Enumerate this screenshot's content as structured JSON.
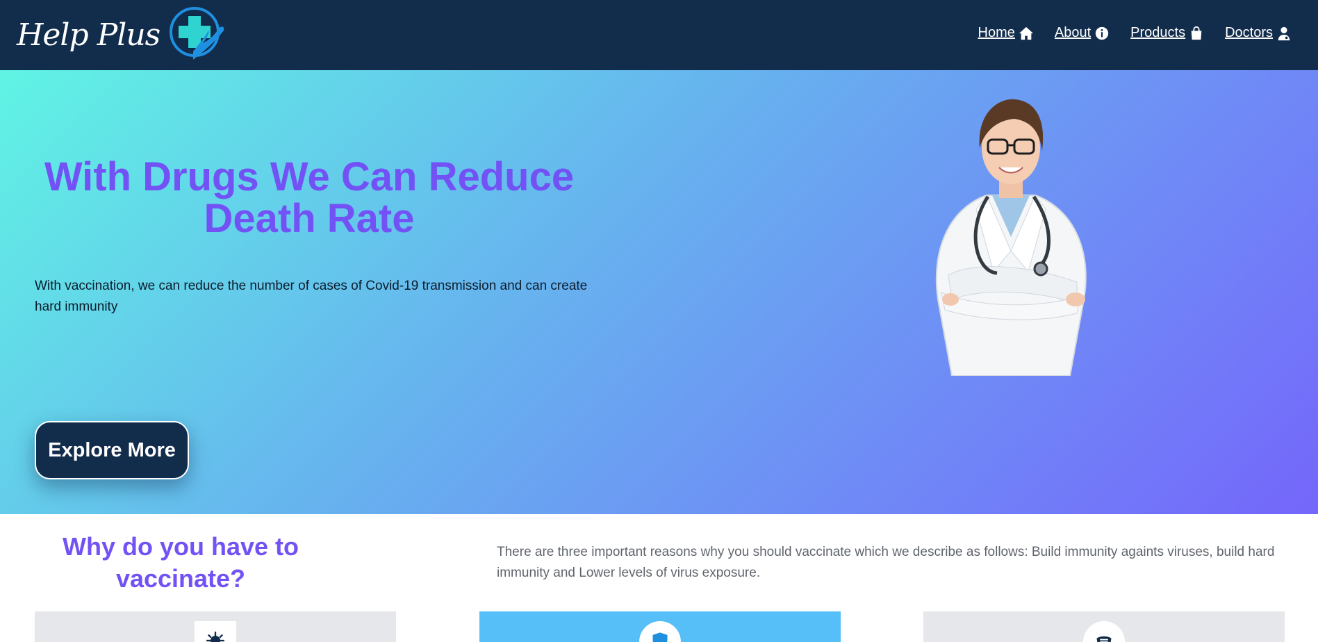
{
  "brand": {
    "name": "Help Plus",
    "logo_icon": "medical-cross-hand-icon"
  },
  "nav": {
    "items": [
      {
        "label": "Home",
        "icon": "home-icon"
      },
      {
        "label": "About",
        "icon": "info-icon"
      },
      {
        "label": "Products",
        "icon": "shopping-bag-icon"
      },
      {
        "label": "Doctors",
        "icon": "doctor-icon"
      }
    ]
  },
  "hero": {
    "title": "With Drugs We Can Reduce Death Rate",
    "subtitle": "With vaccination, we can reduce the number of cases of Covid-19 transmission and can create hard immunity",
    "cta_label": "Explore More",
    "image": "doctor-portrait"
  },
  "why": {
    "title": "Why do you have to vaccinate?",
    "text": "There are three important reasons why you should vaccinate which we describe as follows: Build immunity againts viruses, build hard immunity and Lower levels of virus exposure."
  },
  "cards": [
    {
      "icon": "virus-icon"
    },
    {
      "icon": "shield-icon"
    },
    {
      "icon": "mask-icon"
    }
  ],
  "colors": {
    "navbar": "#122d4c",
    "accent": "#7352f5",
    "card_highlight": "#56bff8",
    "card_muted": "#e6e7ea"
  }
}
